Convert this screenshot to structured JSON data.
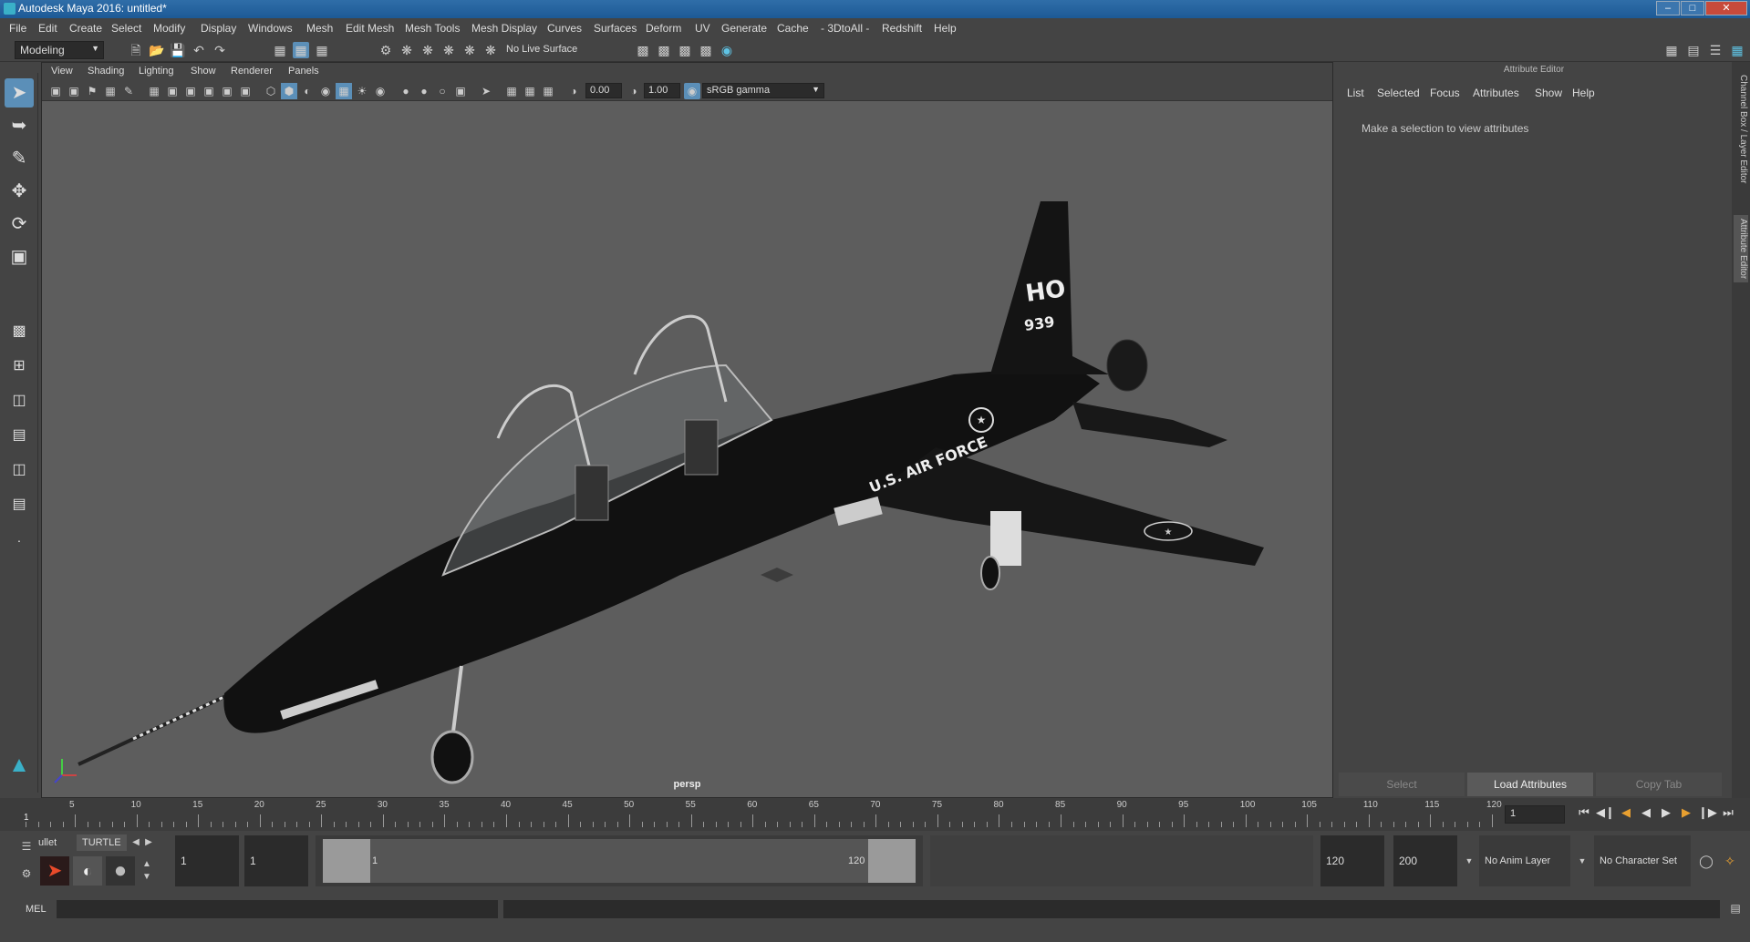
{
  "window": {
    "title": "Autodesk Maya 2016: untitled*"
  },
  "menubar": {
    "items": [
      "File",
      "Edit",
      "Create",
      "Select",
      "Modify",
      "Display",
      "Windows",
      "Mesh",
      "Edit Mesh",
      "Mesh Tools",
      "Mesh Display",
      "Curves",
      "Surfaces",
      "Deform",
      "UV",
      "Generate",
      "Cache",
      "- 3DtoAll -",
      "Redshift",
      "Help"
    ]
  },
  "statusline": {
    "mode": "Modeling",
    "live_surface": "No Live Surface"
  },
  "viewport": {
    "menu": [
      "View",
      "Shading",
      "Lighting",
      "Show",
      "Renderer",
      "Panels"
    ],
    "exposure": "0.00",
    "gamma": "1.00",
    "color_space": "sRGB gamma",
    "camera": "persp",
    "model_text": {
      "tail_code": "HO",
      "tail_number": "939",
      "fuselage": "U.S. AIR FORCE"
    }
  },
  "attribute_editor": {
    "title": "Attribute Editor",
    "menu": [
      "List",
      "Selected",
      "Focus",
      "Attributes",
      "Show",
      "Help"
    ],
    "message": "Make a selection to view attributes",
    "buttons": {
      "select": "Select",
      "load": "Load Attributes",
      "copy": "Copy Tab"
    },
    "side_tabs": [
      "Channel Box / Layer Editor",
      "Attribute Editor"
    ]
  },
  "timeslider": {
    "ticks": [
      "5",
      "10",
      "15",
      "20",
      "25",
      "30",
      "35",
      "40",
      "45",
      "50",
      "55",
      "60",
      "65",
      "70",
      "75",
      "80",
      "85",
      "90",
      "95",
      "100",
      "105",
      "110",
      "115",
      "120"
    ],
    "start_label": "1",
    "current_frame": "1"
  },
  "range": {
    "shelf_tabs": {
      "bullet": "ullet",
      "turtle": "TURTLE"
    },
    "start": "1",
    "playback_start": "1",
    "slider_start": "1",
    "slider_end": "120",
    "playback_end": "120",
    "end": "200",
    "anim_layer": "No Anim Layer",
    "character_set": "No Character Set"
  },
  "cmdline": {
    "label": "MEL"
  }
}
